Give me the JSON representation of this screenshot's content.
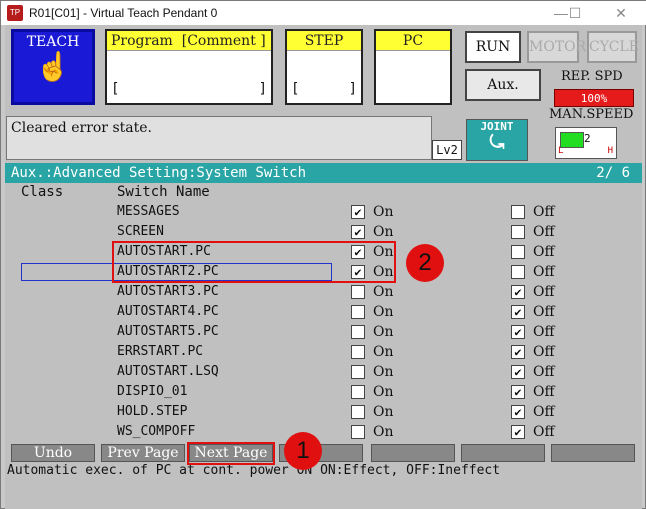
{
  "window": {
    "title": "R01[C01] - Virtual Teach Pendant 0",
    "app_icon": "TP"
  },
  "teach": {
    "label": "TEACH",
    "icon": "hand-pointer-icon"
  },
  "program": {
    "header_left": "Program",
    "header_right": "[Comment ]",
    "bracket_l": "[",
    "bracket_r": "]"
  },
  "step": {
    "header": "STEP",
    "bracket_l": "[",
    "bracket_r": "]"
  },
  "pc": {
    "header": "PC"
  },
  "mode": {
    "run": "RUN",
    "motor": "MOTOR",
    "cycle": "CYCLE",
    "aux": "Aux."
  },
  "rep_spd": {
    "label": "REP. SPD",
    "value": "100%"
  },
  "man_speed": {
    "label": "MAN.SPEED",
    "value": "2",
    "low": "L",
    "high": "H"
  },
  "message": "Cleared error state.",
  "level": "Lv2",
  "joint": {
    "label": "JOINT"
  },
  "screen": {
    "path": "Aux.:Advanced Setting:System Switch",
    "page": "2/  6"
  },
  "columns": {
    "class": "Class",
    "switch_name": "Switch Name"
  },
  "rows": [
    {
      "name": "MESSAGES",
      "on": true,
      "off": false
    },
    {
      "name": "SCREEN",
      "on": true,
      "off": false
    },
    {
      "name": "AUTOSTART.PC",
      "on": true,
      "off": false
    },
    {
      "name": "AUTOSTART2.PC",
      "on": true,
      "off": false
    },
    {
      "name": "AUTOSTART3.PC",
      "on": false,
      "off": true
    },
    {
      "name": "AUTOSTART4.PC",
      "on": false,
      "off": true
    },
    {
      "name": "AUTOSTART5.PC",
      "on": false,
      "off": true
    },
    {
      "name": "ERRSTART.PC",
      "on": false,
      "off": true
    },
    {
      "name": "AUTOSTART.LSQ",
      "on": false,
      "off": true
    },
    {
      "name": "DISPIO_01",
      "on": false,
      "off": true
    },
    {
      "name": "HOLD.STEP",
      "on": false,
      "off": true
    },
    {
      "name": "WS_COMPOFF",
      "on": false,
      "off": true
    }
  ],
  "labels": {
    "on": "On",
    "off": "Off",
    "check": "✔"
  },
  "function_keys": [
    "Undo",
    "Prev Page",
    "Next Page",
    "",
    "",
    "",
    ""
  ],
  "status": "Automatic exec. of PC at cont. power ON    ON:Effect, OFF:Ineffect",
  "callouts": [
    "1",
    "2"
  ]
}
